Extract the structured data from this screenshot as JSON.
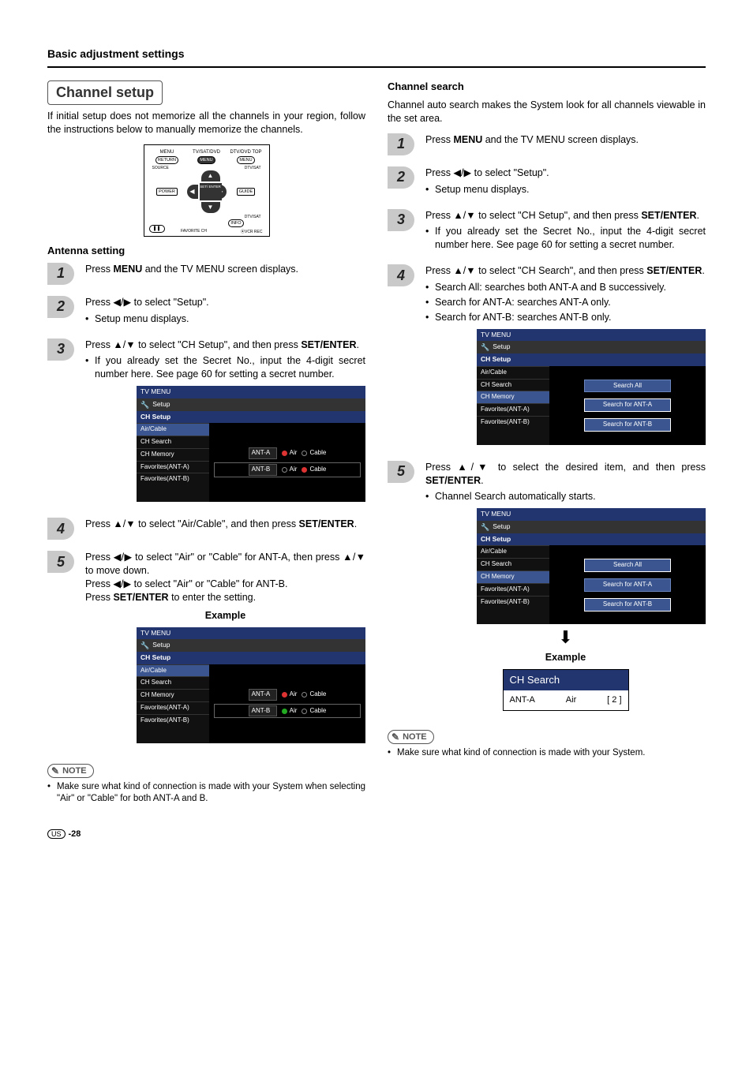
{
  "section_title": "Basic adjustment settings",
  "left": {
    "heading": "Channel setup",
    "intro": "If initial setup does not memorize all the channels in your region, follow the instructions below to manually memorize the channels.",
    "antenna_heading": "Antenna setting",
    "remote": {
      "row1": {
        "l": "MENU",
        "c": "TV/SAT/DVD",
        "r": "DTV/DVD TOP"
      },
      "row2": {
        "l": "RETURN",
        "c": "MENU",
        "r": "MENU"
      },
      "row3": {
        "l": "SOURCE",
        "r": "DTV/SAT"
      },
      "row4": {
        "l": "POWER",
        "r": "GUIDE"
      },
      "center": "SET/\nENTER",
      "row5r": "DTV/SAT",
      "row6r": "INFO",
      "favch": "FAVORITE CH",
      "vcrrec": "VCR REC"
    },
    "steps": {
      "s1a": "Press ",
      "s1b": "MENU",
      "s1c": " and the TV MENU screen displays.",
      "s2a": "Press ◀/▶ to select \"Setup\".",
      "s2b": "Setup menu displays.",
      "s3a": "Press ▲/▼ to select \"CH Setup\", and then press ",
      "s3b": "SET/ENTER",
      "s3c": ".",
      "s3d": "If you already set the Secret No., input the 4-digit secret number here. See page 60 for setting a secret number.",
      "s4a": "Press ▲/▼ to select \"Air/Cable\", and then press ",
      "s4b": "SET/ENTER",
      "s4c": ".",
      "s5a": "Press ◀/▶ to select \"Air\" or \"Cable\" for ANT-A, then press ▲/▼ to move down.",
      "s5b": "Press ◀/▶ to select \"Air\" or \"Cable\" for ANT-B.",
      "s5c": "Press ",
      "s5d": "SET/ENTER",
      "s5e": " to enter the setting."
    },
    "osd": {
      "title": "TV MENU",
      "crumb": "Setup",
      "sel": "CH Setup",
      "items": [
        "Air/Cable",
        "CH Search",
        "CH Memory",
        "Favorites(ANT-A)",
        "Favorites(ANT-B)"
      ],
      "antA": "ANT-A",
      "antB": "ANT-B",
      "air": "Air",
      "cable": "Cable"
    },
    "example_label": "Example",
    "note_label": "NOTE",
    "note_text": "Make sure what kind of connection is made with your System when selecting \"Air\" or \"Cable\" for both ANT-A and B."
  },
  "right": {
    "heading": "Channel search",
    "intro": "Channel auto search makes the System look for all channels viewable in the set area.",
    "steps": {
      "s1a": "Press ",
      "s1b": "MENU",
      "s1c": " and the TV MENU screen displays.",
      "s2a": "Press ◀/▶ to select \"Setup\".",
      "s2b": "Setup menu displays.",
      "s3a": "Press ▲/▼ to select \"CH Setup\", and then press ",
      "s3b": "SET/ENTER",
      "s3c": ".",
      "s3d": "If you already set the Secret No., input the 4-digit secret number here. See page 60 for setting a secret number.",
      "s4a": "Press ▲/▼ to select \"CH Search\", and then press ",
      "s4b": "SET/ENTER",
      "s4c": ".",
      "s4d": "Search All: searches both ANT-A and B successively.",
      "s4e": "Search for ANT-A: searches ANT-A only.",
      "s4f": "Search for ANT-B: searches ANT-B only.",
      "s5a": "Press ▲/▼ to select the desired item, and then press ",
      "s5b": "SET/ENTER",
      "s5c": ".",
      "s5d": "Channel Search automatically starts."
    },
    "osd": {
      "title": "TV MENU",
      "crumb": "Setup",
      "sel": "CH Setup",
      "items": [
        "Air/Cable",
        "CH Search",
        "CH Memory",
        "Favorites(ANT-A)",
        "Favorites(ANT-B)"
      ],
      "btn1": "Search All",
      "btn2": "Search for ANT-A",
      "btn3": "Search for ANT-B"
    },
    "example_label": "Example",
    "search_box": {
      "title": "CH Search",
      "ant": "ANT-A",
      "mode": "Air",
      "count": "[     2 ]"
    },
    "note_label": "NOTE",
    "note_text": "Make sure what kind of connection is made with your System."
  },
  "footer": {
    "us": "US",
    "page": "-28"
  }
}
